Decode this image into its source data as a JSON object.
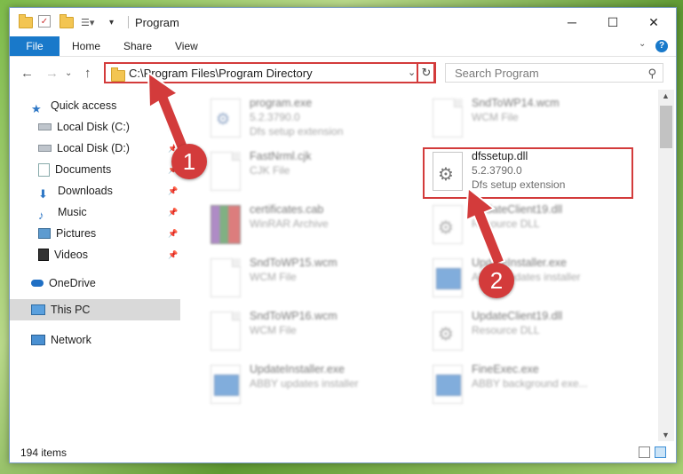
{
  "window": {
    "title": "Program",
    "minimize": "─",
    "maximize": "☐",
    "close": "✕"
  },
  "ribbon": {
    "file": "File",
    "home": "Home",
    "share": "Share",
    "view": "View",
    "help": "?",
    "collapse": "⌄"
  },
  "nav": {
    "back": "←",
    "forward": "→",
    "recent": "⌄",
    "up": "↑",
    "address": "C:\\Program Files\\Program Directory",
    "address_dropdown": "⌄",
    "refresh": "↻",
    "search_placeholder": "Search Program",
    "search_icon": "search-icon"
  },
  "sidebar": {
    "items": [
      {
        "label": "Quick access",
        "icon": "star-icon",
        "pinned": false
      },
      {
        "label": "Local Disk (C:)",
        "icon": "drive-icon",
        "pinned": true
      },
      {
        "label": "Local Disk (D:)",
        "icon": "drive-icon",
        "pinned": true
      },
      {
        "label": "Documents",
        "icon": "documents-icon",
        "pinned": true
      },
      {
        "label": "Downloads",
        "icon": "downloads-icon",
        "pinned": true
      },
      {
        "label": "Music",
        "icon": "music-icon",
        "pinned": true
      },
      {
        "label": "Pictures",
        "icon": "pictures-icon",
        "pinned": true
      },
      {
        "label": "Videos",
        "icon": "videos-icon",
        "pinned": true
      },
      {
        "label": "OneDrive",
        "icon": "onedrive-icon",
        "pinned": false
      },
      {
        "label": "This PC",
        "icon": "pc-icon",
        "pinned": false,
        "selected": true
      },
      {
        "label": "Network",
        "icon": "network-icon",
        "pinned": false
      }
    ],
    "pin_glyph": "📌"
  },
  "files": [
    {
      "name": "program.exe",
      "line2": "5.2.3790.0",
      "line3": "Dfs setup extension",
      "icon": "setup-icon",
      "blurred": true
    },
    {
      "name": "SndToWP14.wcm",
      "line2": "WCM File",
      "line3": "",
      "icon": "document-icon",
      "blurred": true
    },
    {
      "name": "FastNrml.cjk",
      "line2": "CJK File",
      "line3": "",
      "icon": "document-icon",
      "blurred": true
    },
    {
      "name": "dfssetup.dll",
      "line2": "5.2.3790.0",
      "line3": "Dfs setup extension",
      "icon": "dll-gear-icon",
      "blurred": false
    },
    {
      "name": "certificates.cab",
      "line2": "WinRAR Archive",
      "line3": "",
      "icon": "winrar-icon",
      "blurred": true
    },
    {
      "name": "UpdateClient19.dll",
      "line2": "Resource DLL",
      "line3": "",
      "icon": "dll-gear-icon",
      "blurred": true
    },
    {
      "name": "SndToWP15.wcm",
      "line2": "WCM File",
      "line3": "",
      "icon": "document-icon",
      "blurred": true
    },
    {
      "name": "UpdateInstaller.exe",
      "line2": "ABBY updates installer",
      "line3": "",
      "icon": "exe-window-icon",
      "blurred": true
    },
    {
      "name": "SndToWP16.wcm",
      "line2": "WCM File",
      "line3": "",
      "icon": "document-icon",
      "blurred": true
    },
    {
      "name": "UpdateClient19.dll",
      "line2": "Resource DLL",
      "line3": "",
      "icon": "dll-gear-icon",
      "blurred": true
    },
    {
      "name": "UpdateInstaller.exe",
      "line2": "ABBY updates installer",
      "line3": "",
      "icon": "exe-window-icon",
      "blurred": true
    },
    {
      "name": "FineExec.exe",
      "line2": "ABBY background exe...",
      "line3": "",
      "icon": "exe-window-icon",
      "blurred": true
    }
  ],
  "status": {
    "count": "194 items"
  },
  "annotations": {
    "step1": "1",
    "step2": "2",
    "accent": "#d33b3b"
  }
}
